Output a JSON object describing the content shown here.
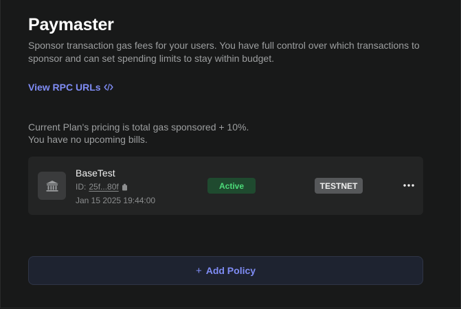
{
  "header": {
    "title": "Paymaster",
    "description": "Sponsor transaction gas fees for your users. You have full control over which transactions to sponsor and can set spending limits to stay within budget."
  },
  "rpc_link": {
    "label": "View RPC URLs",
    "icon": "code-icon"
  },
  "pricing": {
    "line1": "Current Plan's pricing is total gas sponsored + 10%.",
    "line2": "You have no upcoming bills."
  },
  "policies": [
    {
      "name": "BaseTest",
      "id_label": "ID:",
      "id_value": "25f...80f",
      "created": "Jan 15 2025 19:44:00",
      "status": "Active",
      "network": "TESTNET",
      "icon": "bank-icon"
    }
  ],
  "add_policy": {
    "label": "Add Policy",
    "icon": "plus-icon"
  },
  "colors": {
    "background": "#181919",
    "card": "#232424",
    "accent": "#7f8cf4",
    "active_text": "#4ddc7a",
    "active_bg": "#1f4a2f",
    "network_bg": "#56585a"
  }
}
